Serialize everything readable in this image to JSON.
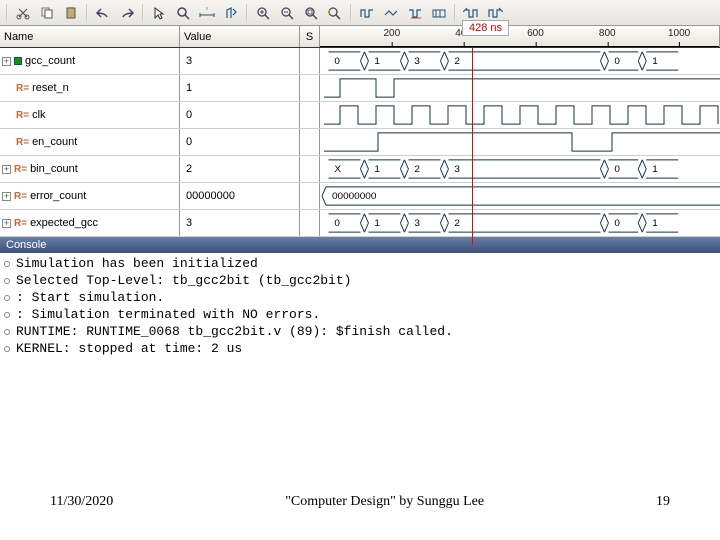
{
  "toolbar": {
    "icons": [
      "cut",
      "copy",
      "paste",
      "undo",
      "redo",
      "pointer",
      "zoom",
      "measure",
      "goto",
      "zoom-in",
      "zoom-out",
      "zoom-fit",
      "zoom-range",
      "wave-a",
      "wave-b",
      "wave-c",
      "wave-d",
      "step-a",
      "step-b"
    ]
  },
  "headers": {
    "name": "Name",
    "value": "Value",
    "s": "S",
    "ticks": [
      "200",
      "400",
      "600",
      "800",
      "1000"
    ]
  },
  "cursor": "428 ns",
  "signals": [
    {
      "expand": true,
      "dot": "#1c8c1c",
      "tag": "",
      "name": "gcc_count",
      "value": "3",
      "type": "bus",
      "segs": [
        "0",
        "1",
        "3",
        "2",
        "0",
        "1"
      ]
    },
    {
      "expand": false,
      "dot": "",
      "tag": "R=",
      "name": "reset_n",
      "value": "1",
      "type": "reset"
    },
    {
      "expand": false,
      "dot": "",
      "tag": "R=",
      "name": "clk",
      "value": "0",
      "type": "clk"
    },
    {
      "expand": false,
      "dot": "",
      "tag": "R=",
      "name": "en_count",
      "value": "0",
      "type": "en"
    },
    {
      "expand": true,
      "dot": "",
      "tag": "R=",
      "name": "bin_count",
      "value": "2",
      "type": "bus",
      "segs": [
        "X",
        "1",
        "2",
        "3",
        "0",
        "1"
      ]
    },
    {
      "expand": true,
      "dot": "",
      "tag": "R=",
      "name": "error_count",
      "value": "00000000",
      "type": "err"
    },
    {
      "expand": true,
      "dot": "",
      "tag": "R=",
      "name": "expected_gcc",
      "value": "3",
      "type": "bus",
      "segs": [
        "0",
        "1",
        "3",
        "2",
        "0",
        "1"
      ]
    }
  ],
  "console": {
    "title": "Console",
    "lines": [
      "Simulation has been initialized",
      "Selected Top-Level: tb_gcc2bit (tb_gcc2bit)",
      ": Start simulation.",
      ": Simulation terminated with NO errors.",
      "RUNTIME: RUNTIME_0068 tb_gcc2bit.v (89): $finish called.",
      "KERNEL: stopped at time: 2 us"
    ]
  },
  "footer": {
    "date": "11/30/2020",
    "title": "\"Computer Design\" by Sunggu Lee",
    "page": "19"
  }
}
